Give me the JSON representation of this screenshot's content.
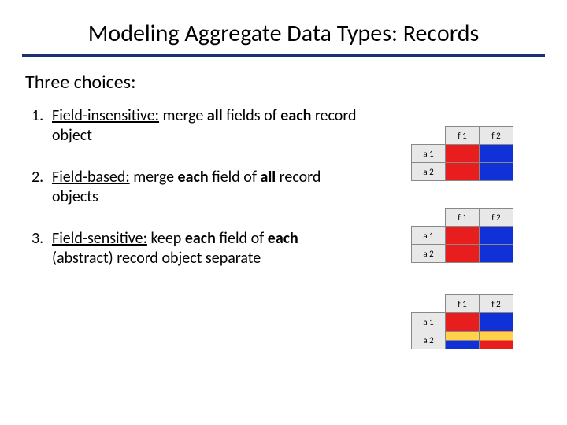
{
  "title": "Modeling Aggregate Data Types: Records",
  "subtitle": "Three choices:",
  "items": [
    {
      "num": "1.",
      "label": "Field-insensitive:",
      "rest_a": " merge ",
      "bold_a": "all",
      "rest_b": " fields of ",
      "bold_b": "each",
      "rest_c": " record object"
    },
    {
      "num": "2.",
      "label": "Field-based:",
      "rest_a": " merge ",
      "bold_a": "each",
      "rest_b": " field of ",
      "bold_b": "all",
      "rest_c": " record objects"
    },
    {
      "num": "3.",
      "label": "Field-sensitive:",
      "rest_a": " keep ",
      "bold_a": "each",
      "rest_b": " field of ",
      "bold_b": "each",
      "rest_c": " (abstract) record object separate"
    }
  ],
  "grids": {
    "cols": [
      "f 1",
      "f 2"
    ],
    "rows": [
      "a 1",
      "a 2"
    ]
  },
  "chart_data": [
    {
      "type": "table",
      "title": "Field-insensitive",
      "columns": [
        "f1",
        "f2"
      ],
      "rows": [
        "a1",
        "a2"
      ],
      "cells": [
        [
          "red",
          "blue"
        ],
        [
          "red",
          "blue"
        ]
      ],
      "note": "single merged column pair: a1/a2 × f1 red, f2 blue"
    },
    {
      "type": "table",
      "title": "Field-based",
      "columns": [
        "f1",
        "f2"
      ],
      "rows": [
        "a1",
        "a2"
      ],
      "cells": [
        [
          "red",
          "blue"
        ],
        [
          "red",
          "blue"
        ]
      ]
    },
    {
      "type": "table",
      "title": "Field-sensitive",
      "columns": [
        "f1",
        "f2"
      ],
      "rows": [
        "a1",
        "a2"
      ],
      "cells": [
        [
          "red",
          "blue"
        ],
        [
          "yellow-blue",
          "yellow-red"
        ]
      ]
    }
  ]
}
